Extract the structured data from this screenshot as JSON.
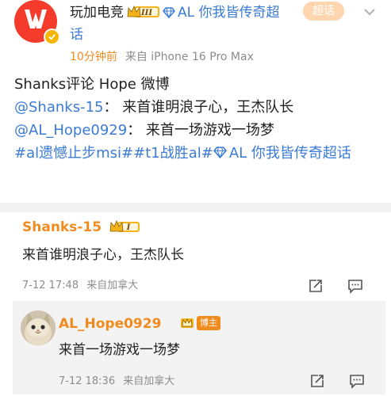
{
  "post": {
    "author": "玩加电竞",
    "level": "III",
    "topic_prefix": "AL 你我皆传奇超",
    "topic_suffix": "话",
    "follow_label": "超话",
    "time": "10分钟前",
    "source": "来自 iPhone 16 Pro Max",
    "body": {
      "line1": "Shanks评论 Hope 微博",
      "mention1": "@Shanks-15",
      "quote1": "：  来首谁明浪子心，王杰队长",
      "mention2": "@AL_Hope0929",
      "quote2": "：  来首一场游戏一场梦",
      "tags": "#al遗憾止步msi##t1战胜al#",
      "topic": "AL 你我皆传奇超话"
    }
  },
  "comments": [
    {
      "author": "Shanks-15",
      "level": "I",
      "text": "来首谁明浪子心，王杰队长",
      "time": "7-12 17:48",
      "location": "来自加拿大"
    }
  ],
  "reply": {
    "author": "AL_Hope0929",
    "host_badge": "博主",
    "text": "来首一场游戏一场梦",
    "time": "7-12 18:36",
    "location": "来自加拿大"
  },
  "colors": {
    "accent_orange": "#f08c1f",
    "link_blue": "#3a7bd5",
    "brand_red": "#f43b2c"
  }
}
